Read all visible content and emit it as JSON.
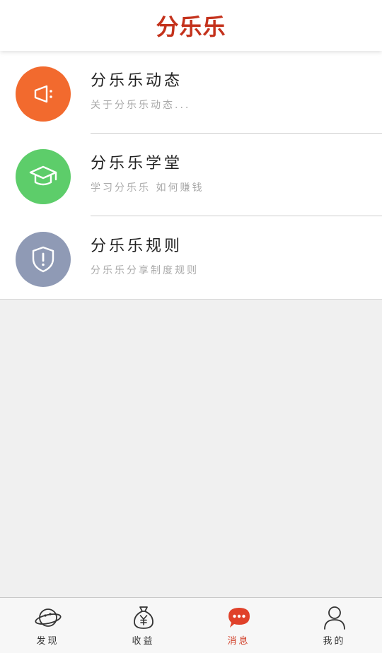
{
  "header": {
    "title": "分乐乐"
  },
  "colors": {
    "brand": "#c4321c",
    "news_icon_bg": "#f26a2e",
    "school_icon_bg": "#5dcd6a",
    "rules_icon_bg": "#8f9ab5",
    "active_tab": "#d03a22"
  },
  "messages": [
    {
      "icon": "megaphone-icon",
      "title": "分乐乐动态",
      "subtitle": "关于分乐乐动态..."
    },
    {
      "icon": "graduation-cap-icon",
      "title": "分乐乐学堂",
      "subtitle": "学习分乐乐 如何赚钱"
    },
    {
      "icon": "shield-alert-icon",
      "title": "分乐乐规则",
      "subtitle": "分乐乐分享制度规则"
    }
  ],
  "tabbar": {
    "items": [
      {
        "icon": "planet-icon",
        "label": "发现"
      },
      {
        "icon": "money-bag-icon",
        "label": "收益"
      },
      {
        "icon": "chat-bubble-icon",
        "label": "消息",
        "active": true
      },
      {
        "icon": "person-icon",
        "label": "我的"
      }
    ]
  }
}
